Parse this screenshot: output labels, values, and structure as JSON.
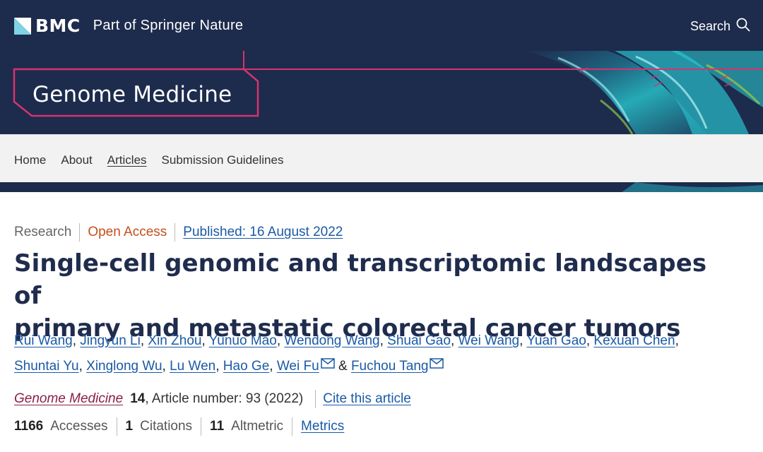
{
  "header": {
    "brand": "BMC",
    "tagline": "Part of Springer Nature",
    "search_label": "Search"
  },
  "journal": {
    "title": "Genome Medicine"
  },
  "nav": {
    "items": [
      "Home",
      "About",
      "Articles",
      "Submission Guidelines"
    ],
    "active": "Articles"
  },
  "article": {
    "type": "Research",
    "access": "Open Access",
    "published": "Published: 16 August 2022",
    "title_line1": "Single-cell genomic and transcriptomic landscapes of",
    "title_line2": "primary and metastatic colorectal cancer tumors",
    "authors": [
      "Rui Wang",
      "Jingyun Li",
      "Xin Zhou",
      "Yunuo Mao",
      "Wendong Wang",
      "Shuai Gao",
      "Wei Wang",
      "Yuan Gao",
      "Kexuan Chen",
      "Shuntai Yu",
      "Xinglong Wu",
      "Lu Wen",
      "Hao Ge",
      "Wei Fu",
      "Fuchou Tang"
    ],
    "author_ampersand": "&",
    "journal_name": "Genome Medicine",
    "volume": "14",
    "article_number": ", Article number: 93 (2022)",
    "cite_label": "Cite this article"
  },
  "metrics": {
    "accesses_value": "1166",
    "accesses_label": "Accesses",
    "citations_value": "1",
    "citations_label": "Citations",
    "altmetric_value": "11",
    "altmetric_label": "Altmetric",
    "metrics_link": "Metrics"
  },
  "colors": {
    "navy": "#1d2b4d",
    "accent_pink": "#d6336c",
    "open_access": "#c4501c",
    "link": "#1a5aa6",
    "journal_link": "#8a1f4a"
  }
}
